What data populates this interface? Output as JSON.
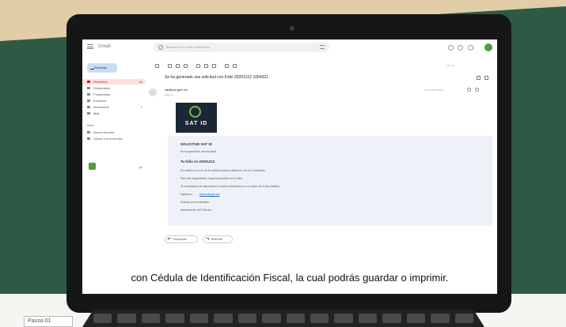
{
  "caption": "con Cédula de Identificación Fiscal, la cual podrás guardar o imprimir.",
  "pausa_label": "Pausa 01",
  "gmail": {
    "brand": "Gmail",
    "search_placeholder": "Buscar en el correo electrónico",
    "compose_label": "Redactar",
    "sidebar": [
      {
        "label": "Recibidos",
        "count": "19",
        "active": true
      },
      {
        "label": "Destacados"
      },
      {
        "label": "Pospuestos"
      },
      {
        "label": "Enviados"
      },
      {
        "label": "Borradores",
        "count": "1"
      },
      {
        "label": "Más"
      }
    ],
    "sidebar_section": "Meet",
    "meet_items": [
      {
        "label": "Nueva reunión"
      },
      {
        "label": "Unirse a una reunión"
      }
    ],
    "pager": "1 de 19",
    "subject": "Se ha generado una solicitud con Folio 20201212 1004321",
    "sender": "sat@sat.gob.mx",
    "to": "para mí",
    "date": "12 dic 2020 10:04",
    "logo_text": "SAT ID",
    "card": {
      "title": "SOLICITUD SAT ID",
      "lines": [
        "Se ha generado una solicitud",
        "Tu folio es 20201212",
        "Se realizó el envío de la solicitud para la obtención de tu Contraseña.",
        "Para dar seguimiento, ingresa al portal con tu folio.",
        "Te enviaremos la respuesta a tu correo electrónico en un plazo de 5 días hábiles.",
        "Ingresa a:",
        "Gracias por tu atención.",
        "Atentamente SAT México"
      ],
      "link": "www.sat.gob.mx"
    },
    "reply_label": "Responder",
    "forward_label": "Reenviar"
  }
}
